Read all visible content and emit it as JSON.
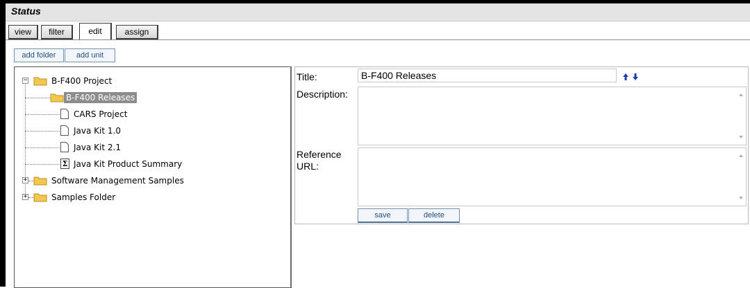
{
  "header": {
    "title": "Status"
  },
  "tabs": [
    {
      "label": "view"
    },
    {
      "label": "filter"
    },
    {
      "label": "edit",
      "active": true
    },
    {
      "label": "assign"
    }
  ],
  "actions": {
    "add_folder": "add folder",
    "add_unit": "add unit"
  },
  "tree": {
    "nodes": [
      {
        "label": "B-F400 Project",
        "type": "folder",
        "expanded": true
      },
      {
        "label": "B-F400 Releases",
        "type": "folder",
        "selected": true
      },
      {
        "label": "CARS Project",
        "type": "document"
      },
      {
        "label": "Java Kit 1.0",
        "type": "document"
      },
      {
        "label": "Java Kit 2.1",
        "type": "document"
      },
      {
        "label": "Java Kit Product Summary",
        "type": "summary"
      },
      {
        "label": "Software Management Samples",
        "type": "folder",
        "expanded": false
      },
      {
        "label": "Samples Folder",
        "type": "folder",
        "expanded": false
      }
    ]
  },
  "form": {
    "title_label": "Title:",
    "title_value": "B-F400 Releases",
    "description_label": "Description:",
    "description_value": "",
    "reference_label_1": "Reference",
    "reference_label_2": "URL:",
    "reference_value": "",
    "save_label": "save",
    "delete_label": "delete"
  },
  "colors": {
    "selected_bg": "#8c8c8c",
    "button_text": "#1f4f82",
    "arrow_blue": "#1f3fb0",
    "folder_yellow": "#f2c94c"
  }
}
